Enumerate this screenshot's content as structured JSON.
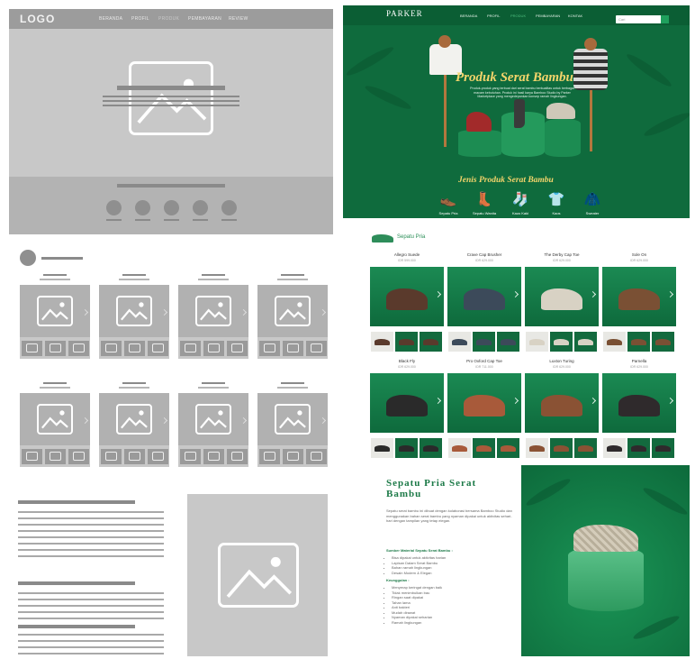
{
  "wireframe": {
    "nav": {
      "logo": "LOGO",
      "menu": [
        "BERANDA",
        "PROFIL",
        "PRODUK",
        "PEMBAYARAN",
        "REVIEW"
      ]
    }
  },
  "design": {
    "nav": {
      "brand": "PARKER",
      "brand_sub": "",
      "menu": [
        "BERANDA",
        "PROFIL",
        "PRODUK",
        "PEMBAYARAN",
        "KONTAK"
      ],
      "search_placeholder": "Cari"
    },
    "hero": {
      "title": "Produk Serat Bambu",
      "description": "Produk-produk yang terbuat dari serat bambu berkualitas untuk berbagai macam kebutuhan. Produk ini hasil karya Bamboo Studio by Parker Marketplace yang mengedepankan konsep ramah lingkungan."
    },
    "categories_title": "Jenis Produk Serat Bambu",
    "categories": [
      {
        "label": "Sepatu Pria",
        "icon": "men-shoe-icon"
      },
      {
        "label": "Sepatu Wanita",
        "icon": "women-shoe-icon"
      },
      {
        "label": "Kaus Kaki",
        "icon": "sock-icon"
      },
      {
        "label": "Kaos",
        "icon": "tshirt-icon"
      },
      {
        "label": "Sweater",
        "icon": "sweater-icon"
      }
    ],
    "section_label": "Sepatu Pria",
    "products": [
      {
        "name": "Allegro Suede",
        "price": "IDR 599.000",
        "color": "#5a3a2c"
      },
      {
        "name": "Crave Cap Brusher",
        "price": "IDR 629.000",
        "color": "#3c4a5a"
      },
      {
        "name": "The Derby Cap Toe",
        "price": "IDR 629.000",
        "color": "#d8d2c4"
      },
      {
        "name": "Sole On",
        "price": "IDR 629.000",
        "color": "#7a5034"
      },
      {
        "name": "Black Fly",
        "price": "IDR 629.000",
        "color": "#2a2a2a"
      },
      {
        "name": "Pro Oxford Cap Toe",
        "price": "IDR 711.000",
        "color": "#a85a3a"
      },
      {
        "name": "Luxton Turing",
        "price": "IDR 629.000",
        "color": "#8a5234"
      },
      {
        "name": "Parnella",
        "price": "IDR 629.000",
        "color": "#2f2a2c"
      }
    ],
    "detail": {
      "title": "Sepatu Pria Serat Bambu",
      "paragraph": "Sepatu serat bambu ini dibuat dengan kolaborasi bersama Bamboo Studio dan menggunakan bahan serat bambu yang nyaman dipakai untuk aktivitas sehari-hari dengan tampilan yang tetap elegan.",
      "materials_heading": "Sumber Material Sepatu Serat Bambu :",
      "materials": [
        "Bisa dipakai untuk aktivitas harian",
        "Lapisan Dalam Serat Bambu",
        "Bahan ramah lingkungan",
        "Desain Modern & Elegan"
      ],
      "benefits_heading": "Keunggulan :",
      "benefits": [
        "Menyerap keringat dengan baik",
        "Tidak menimbulkan bau",
        "Ringan saat dipakai",
        "Tahan lama",
        "Anti bakteri",
        "Mudah dirawat",
        "Nyaman dipakai seharian",
        "Ramah lingkungan"
      ]
    }
  },
  "colors": {
    "wire_gray": "#c8c8c8",
    "brand_green": "#0f6b3d",
    "accent_gold": "#f3d46b"
  }
}
